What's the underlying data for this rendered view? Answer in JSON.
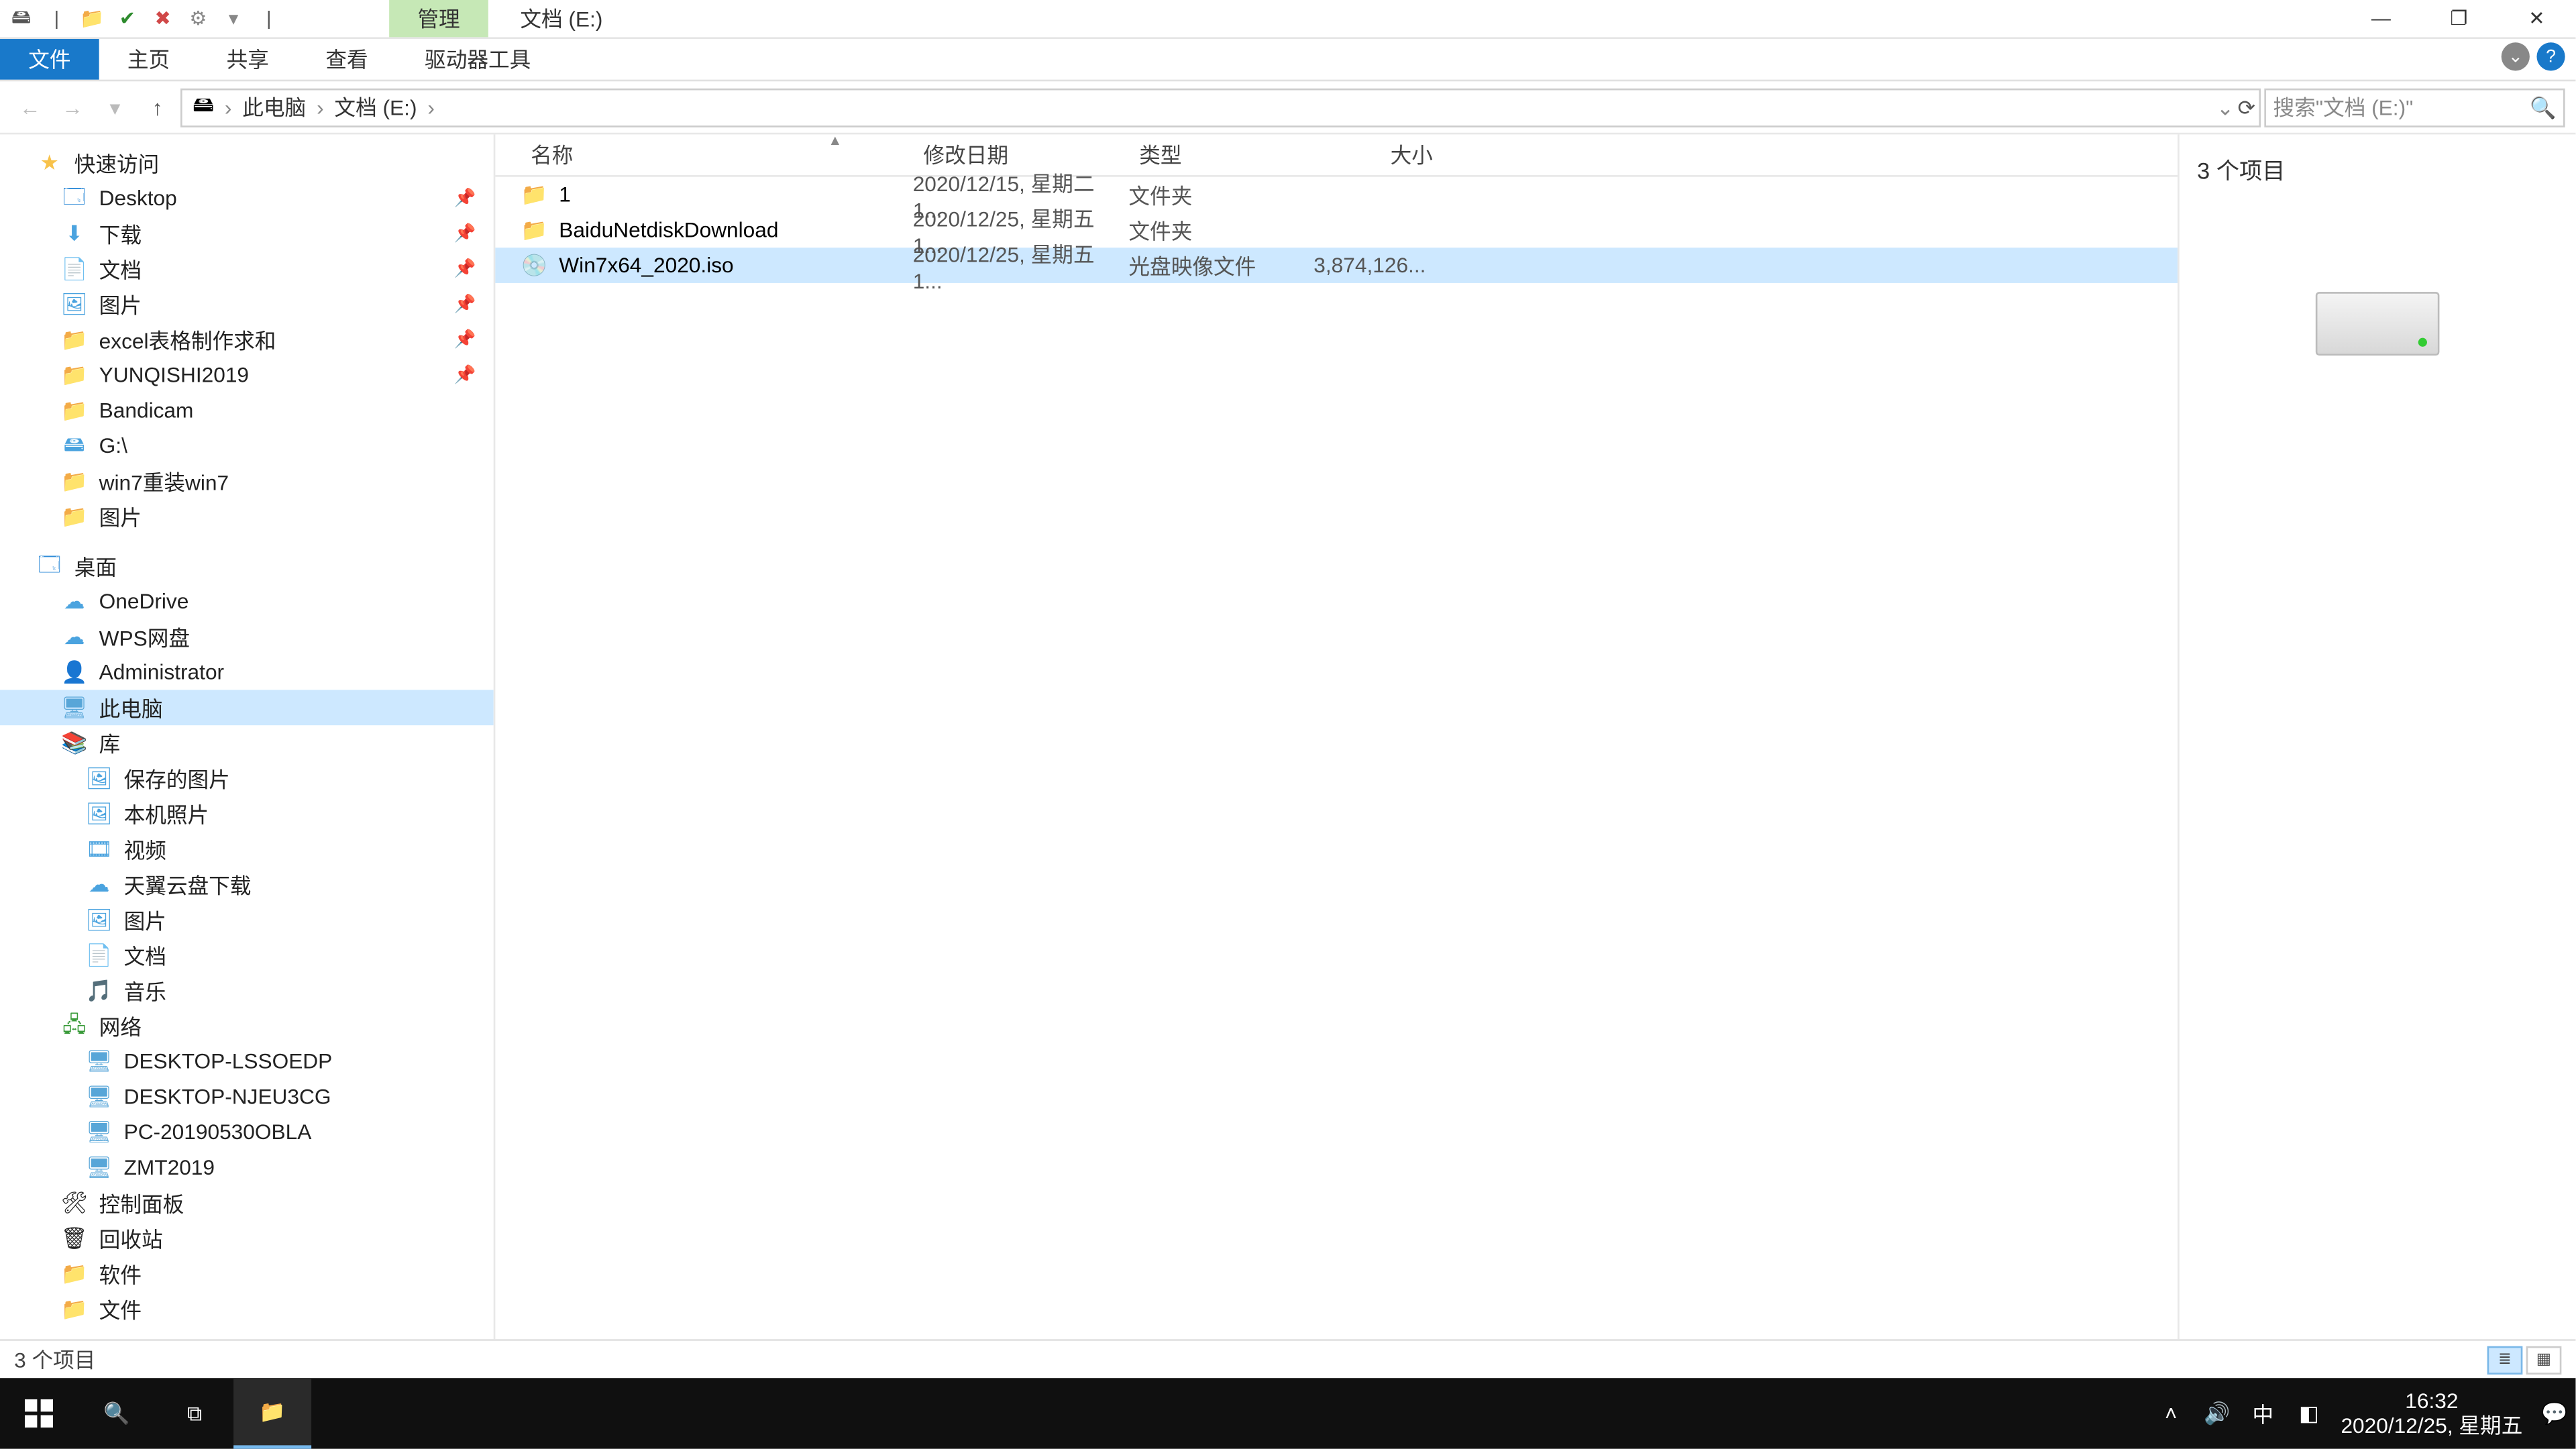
{
  "title": {
    "manage": "管理",
    "location": "文档 (E:)"
  },
  "window_controls": {
    "min": "—",
    "max": "❐",
    "close": "✕"
  },
  "ribbon": {
    "file": "文件",
    "home": "主页",
    "share": "共享",
    "view": "查看",
    "drive": "驱动器工具"
  },
  "crumbs": {
    "pc": "此电脑",
    "drive": "文档 (E:)"
  },
  "search": {
    "placeholder": "搜索\"文档 (E:)\""
  },
  "tree": {
    "quick": "快速访问",
    "q": [
      {
        "n": "Desktop",
        "i": "🗔",
        "c": "ic-desk",
        "pin": true
      },
      {
        "n": "下载",
        "i": "⬇",
        "c": "ic-blue",
        "pin": true
      },
      {
        "n": "文档",
        "i": "📄",
        "c": "ic-blue",
        "pin": true
      },
      {
        "n": "图片",
        "i": "🖼",
        "c": "ic-blue",
        "pin": true
      },
      {
        "n": "excel表格制作求和",
        "i": "📁",
        "c": "ic-folder",
        "pin": true
      },
      {
        "n": "YUNQISHI2019",
        "i": "📁",
        "c": "ic-folder",
        "pin": true
      },
      {
        "n": "Bandicam",
        "i": "📁",
        "c": "ic-folder"
      },
      {
        "n": "G:\\",
        "i": "🖴",
        "c": "ic-blue"
      },
      {
        "n": "win7重装win7",
        "i": "📁",
        "c": "ic-folder"
      },
      {
        "n": "图片",
        "i": "📁",
        "c": "ic-folder"
      }
    ],
    "desktop": "桌面",
    "d": [
      {
        "n": "OneDrive",
        "i": "☁",
        "c": "ic-blue"
      },
      {
        "n": "WPS网盘",
        "i": "☁",
        "c": "ic-blue"
      },
      {
        "n": "Administrator",
        "i": "👤",
        "c": "ic-folder"
      },
      {
        "n": "此电脑",
        "i": "🖥",
        "c": "ic-pc",
        "sel": true
      },
      {
        "n": "库",
        "i": "📚",
        "c": "ic-folder"
      }
    ],
    "lib": [
      {
        "n": "保存的图片",
        "i": "🖼",
        "c": "ic-blue"
      },
      {
        "n": "本机照片",
        "i": "🖼",
        "c": "ic-blue"
      },
      {
        "n": "视频",
        "i": "🎞",
        "c": "ic-blue"
      },
      {
        "n": "天翼云盘下载",
        "i": "☁",
        "c": "ic-blue"
      },
      {
        "n": "图片",
        "i": "🖼",
        "c": "ic-blue"
      },
      {
        "n": "文档",
        "i": "📄",
        "c": "ic-blue"
      },
      {
        "n": "音乐",
        "i": "🎵",
        "c": "ic-blue"
      }
    ],
    "network": "网络",
    "net": [
      {
        "n": "DESKTOP-LSSOEDP",
        "i": "🖥",
        "c": "ic-pc"
      },
      {
        "n": "DESKTOP-NJEU3CG",
        "i": "🖥",
        "c": "ic-pc"
      },
      {
        "n": "PC-20190530OBLA",
        "i": "🖥",
        "c": "ic-pc"
      },
      {
        "n": "ZMT2019",
        "i": "🖥",
        "c": "ic-pc"
      }
    ],
    "ctrl": "控制面板",
    "recycle": "回收站",
    "soft": "软件",
    "docs": "文件"
  },
  "columns": {
    "name": "名称",
    "date": "修改日期",
    "type": "类型",
    "size": "大小"
  },
  "rows": [
    {
      "name": "1",
      "date": "2020/12/15, 星期二 1...",
      "type": "文件夹",
      "size": "",
      "icon": "📁",
      "ic": "ic-folder"
    },
    {
      "name": "BaiduNetdiskDownload",
      "date": "2020/12/25, 星期五 1...",
      "type": "文件夹",
      "size": "",
      "icon": "📁",
      "ic": "ic-folder"
    },
    {
      "name": "Win7x64_2020.iso",
      "date": "2020/12/25, 星期五 1...",
      "type": "光盘映像文件",
      "size": "3,874,126...",
      "icon": "💿",
      "ic": "ic-disc",
      "sel": true
    }
  ],
  "preview": {
    "count": "3 个项目"
  },
  "status": {
    "count": "3 个项目"
  },
  "tray": {
    "time": "16:32",
    "date": "2020/12/25, 星期五",
    "ime": "中"
  }
}
